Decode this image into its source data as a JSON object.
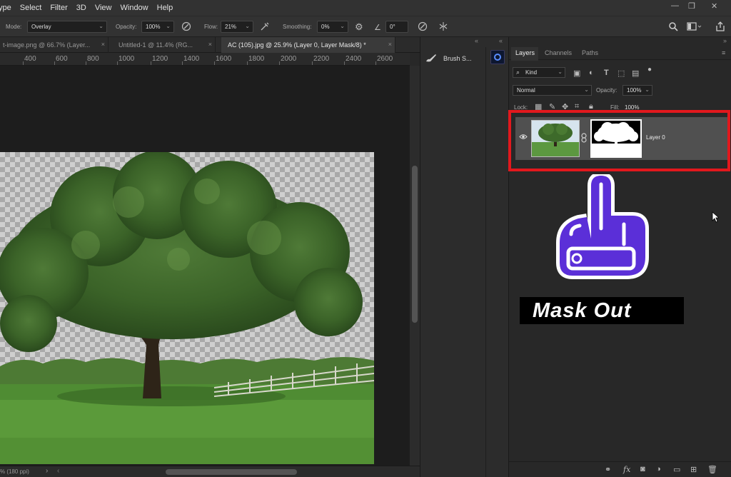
{
  "menubar": {
    "items": [
      "ype",
      "Select",
      "Filter",
      "3D",
      "View",
      "Window",
      "Help"
    ],
    "minimize": "—",
    "restore": "❐",
    "close": "✕"
  },
  "options": {
    "mode_label": "Mode:",
    "mode_value": "Overlay",
    "opacity_label": "Opacity:",
    "opacity_value": "100%",
    "flow_label": "Flow:",
    "flow_value": "21%",
    "smoothing_label": "Smoothing:",
    "smoothing_value": "0%",
    "angle_value": "0°"
  },
  "tabs": [
    {
      "label": "t-image.png @ 66.7% (Layer...",
      "close": "×"
    },
    {
      "label": "Untitled-1 @ 11.4% (RG...",
      "close": "×"
    },
    {
      "label": "AC (105).jpg @ 25.9% (Layer 0, Layer Mask/8) *",
      "close": "×"
    }
  ],
  "ruler": {
    "labels": [
      "400",
      "600",
      "800",
      "1000",
      "1200",
      "1400",
      "1600",
      "1800",
      "2000",
      "2200",
      "2400",
      "2600"
    ]
  },
  "status": {
    "text": "% (180 ppi)"
  },
  "midpanel": {
    "brush_label": "Brush S..."
  },
  "layers": {
    "tabs": [
      "Layers",
      "Channels",
      "Paths"
    ],
    "kind_value": "Kind",
    "blend_value": "Normal",
    "opacity_label": "Opacity:",
    "opacity_value": "100%",
    "lock_label": "Lock:",
    "fill_label": "Fill:",
    "fill_value": "100%",
    "layer_name": "Layer 0"
  },
  "overlay": {
    "caption": "Mask Out"
  },
  "colors": {
    "highlight": "#e2181d",
    "hand_fill": "#5b2fd8",
    "app_bg": "#282828"
  },
  "icons": {
    "hand": "pointing-hand-icon",
    "eye": "eye-icon",
    "chain": "chain-link-icon"
  }
}
